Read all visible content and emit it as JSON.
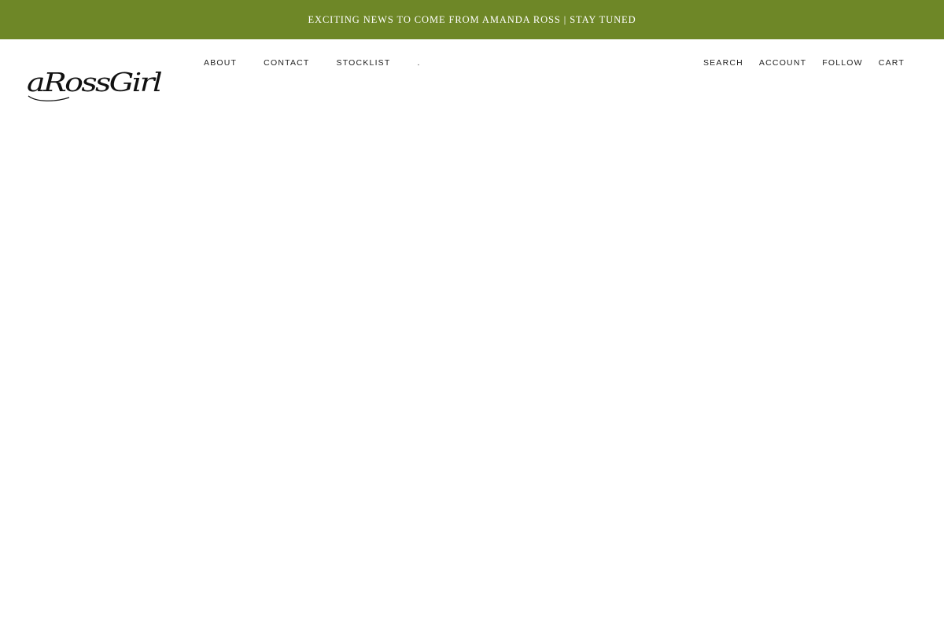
{
  "colors": {
    "announcement_bg": "#6e8727",
    "announcement_text": "#ffffff",
    "nav_text": "#222222",
    "background": "#ffffff"
  },
  "announcement": {
    "text": "EXCITING NEWS TO COME FROM AMANDA ROSS | STAY TUNED"
  },
  "header": {
    "logo": {
      "text": "aRossGirl",
      "icon": "script-wordmark-logo"
    },
    "nav_left": [
      {
        "label": "ABOUT"
      },
      {
        "label": "CONTACT"
      },
      {
        "label": "STOCKLIST"
      },
      {
        "label": "."
      }
    ],
    "nav_right": [
      {
        "label": "SEARCH"
      },
      {
        "label": "ACCOUNT"
      },
      {
        "label": "FOLLOW"
      },
      {
        "label": "CART"
      }
    ]
  }
}
